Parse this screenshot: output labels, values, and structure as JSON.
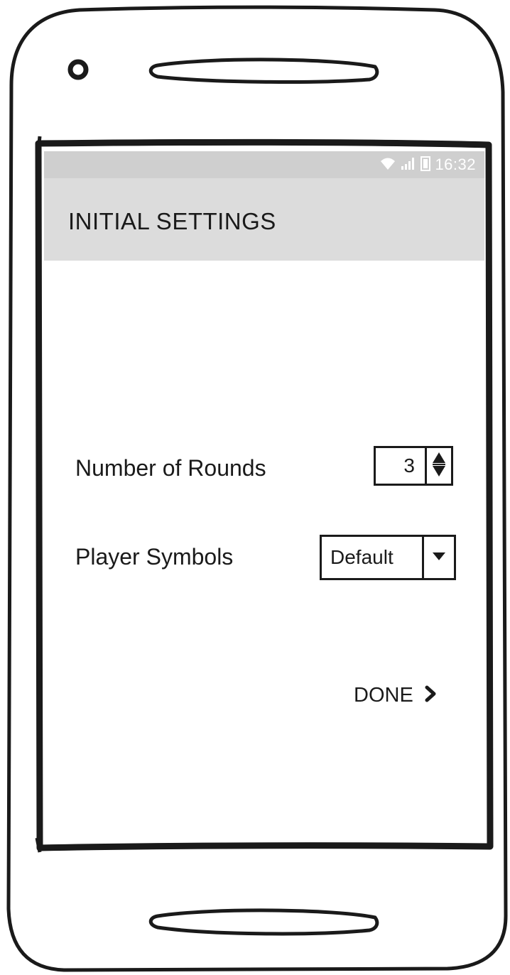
{
  "status_bar": {
    "time": "16:32",
    "icons": [
      "wifi-icon",
      "signal-icon",
      "battery-icon"
    ]
  },
  "app_bar": {
    "title": "INITIAL SETTINGS"
  },
  "settings": {
    "rounds": {
      "label": "Number of Rounds",
      "value": "3"
    },
    "symbols": {
      "label": "Player Symbols",
      "value": "Default"
    }
  },
  "actions": {
    "done_label": "DONE",
    "done_icon": "chevron-right-icon"
  },
  "colors": {
    "status_bar": "#cfcfcf",
    "app_bar": "#dcdcdc",
    "ink": "#1a1a1a"
  }
}
